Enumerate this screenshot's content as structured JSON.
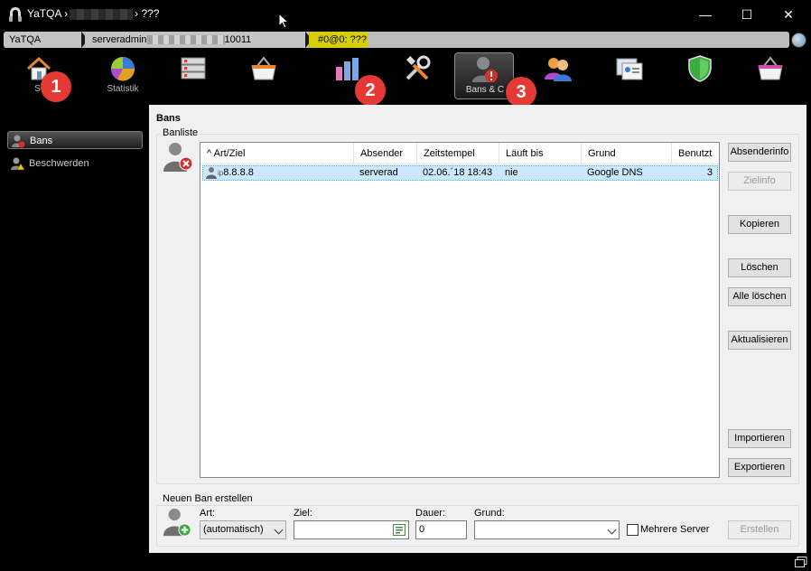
{
  "window": {
    "title_prefix": "YaTQA ›",
    "title_suffix": "› ???",
    "min_glyph": "—",
    "max_glyph": "☐",
    "close_glyph": "✕"
  },
  "breadcrumb": {
    "items": [
      "YaTQA",
      "serveradmin",
      "10011",
      "#0@0: ???"
    ]
  },
  "toolbar": {
    "items": [
      {
        "label": "St",
        "icon": "home-icon"
      },
      {
        "label": "Statistik",
        "icon": "pie-chart-icon"
      },
      {
        "label": "",
        "icon": "server-list-icon"
      },
      {
        "label": "",
        "icon": "basket-icon"
      },
      {
        "label": "",
        "icon": "bar-chart-icon"
      },
      {
        "label": "",
        "icon": "tools-icon"
      },
      {
        "label": "Bans & C",
        "icon": "ban-user-icon"
      },
      {
        "label": "",
        "icon": "users-icon"
      },
      {
        "label": "",
        "icon": "contacts-icon"
      },
      {
        "label": "",
        "icon": "shield-icon"
      },
      {
        "label": "",
        "icon": "basket-pink-icon"
      }
    ],
    "markers": [
      "1",
      "2",
      "3"
    ]
  },
  "sidebar": {
    "items": [
      {
        "label": "Bans",
        "icon": "ban-user-icon",
        "selected": true
      },
      {
        "label": "Beschwerden",
        "icon": "warning-user-icon",
        "selected": false
      }
    ]
  },
  "bans": {
    "title": "Bans",
    "group_title": "Banliste",
    "columns": [
      "^ Art/Ziel",
      "Absender",
      "Zeitstempel",
      "Läuft bis",
      "Grund",
      "Benutzt"
    ],
    "rows": [
      {
        "type": "ip",
        "target": "8.8.8.8",
        "sender": "serverad",
        "timestamp": "02.06.´18 18:43",
        "expires": "nie",
        "reason": "Google DNS",
        "used": "3"
      }
    ],
    "buttons": {
      "absenderinfo": "Absenderinfo",
      "zielinfo": "Zielinfo",
      "kopieren": "Kopieren",
      "loeschen": "Löschen",
      "alle_loeschen": "Alle löschen",
      "aktualisieren": "Aktualisieren",
      "importieren": "Importieren",
      "exportieren": "Exportieren"
    }
  },
  "new_ban": {
    "group_title": "Neuen Ban erstellen",
    "art_label": "Art:",
    "art_value": "(automatisch)",
    "ziel_label": "Ziel:",
    "ziel_value": "",
    "dauer_label": "Dauer:",
    "dauer_value": "0",
    "grund_label": "Grund:",
    "grund_value": "",
    "multi_server_label": "Mehrere Server",
    "create_button": "Erstellen"
  },
  "colors": {
    "selected_row": "#cce8ff",
    "crumb_highlight": "#d6d000",
    "marker": "#e53935"
  }
}
